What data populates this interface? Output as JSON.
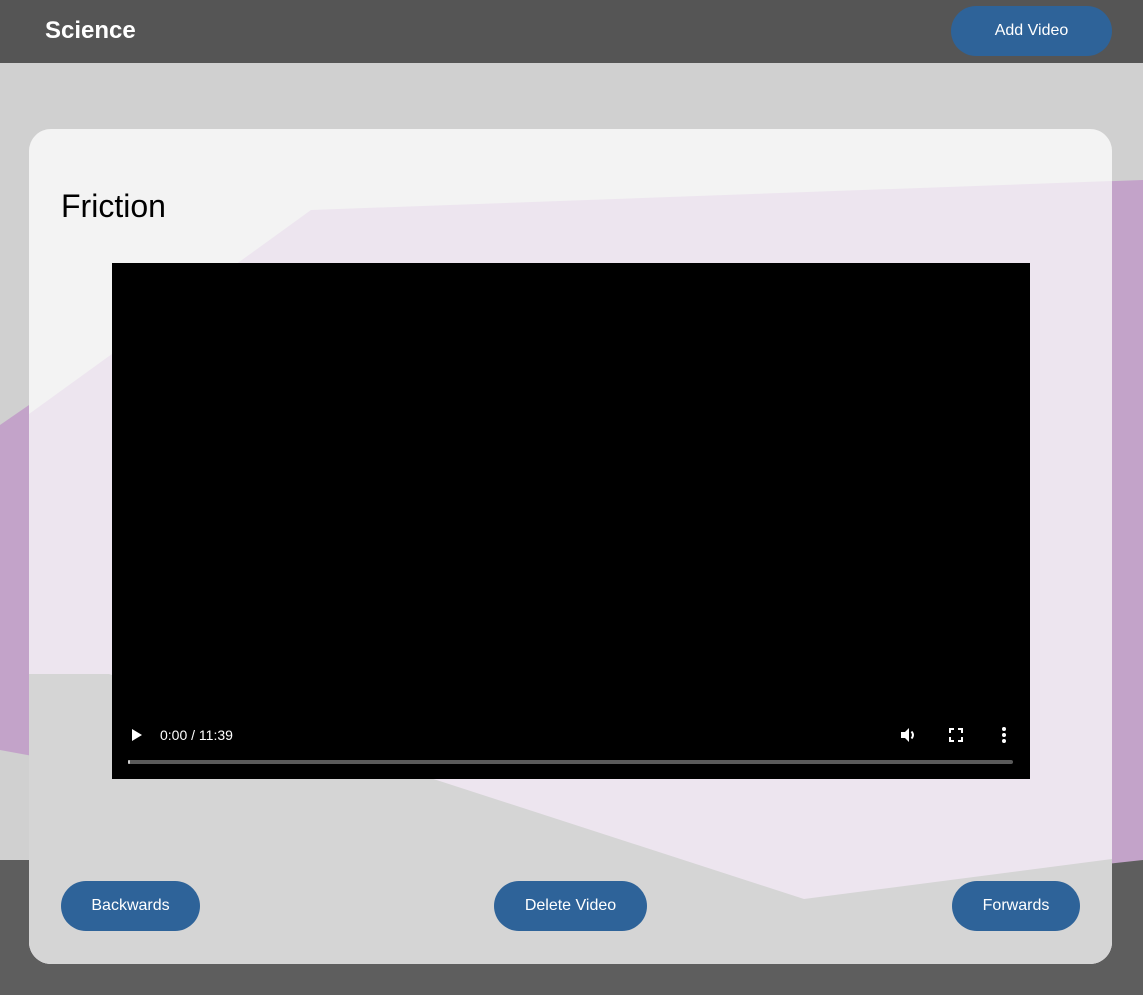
{
  "header": {
    "title": "Science",
    "add_video_label": "Add Video"
  },
  "video": {
    "title": "Friction",
    "time_display": "0:00 / 11:39",
    "progress_fraction": 0.0,
    "play_icon": "play-icon",
    "volume_icon": "volume-icon",
    "fullscreen_icon": "fullscreen-icon",
    "more_icon": "more-options-icon"
  },
  "navigation": {
    "backwards_label": "Backwards",
    "delete_label": "Delete Video",
    "forwards_label": "Forwards"
  },
  "colors": {
    "header_bg": "#555555",
    "button_bg": "#2e6399",
    "accent_purple": "#c3a3c9",
    "card_bg": "#f2f2f2"
  }
}
